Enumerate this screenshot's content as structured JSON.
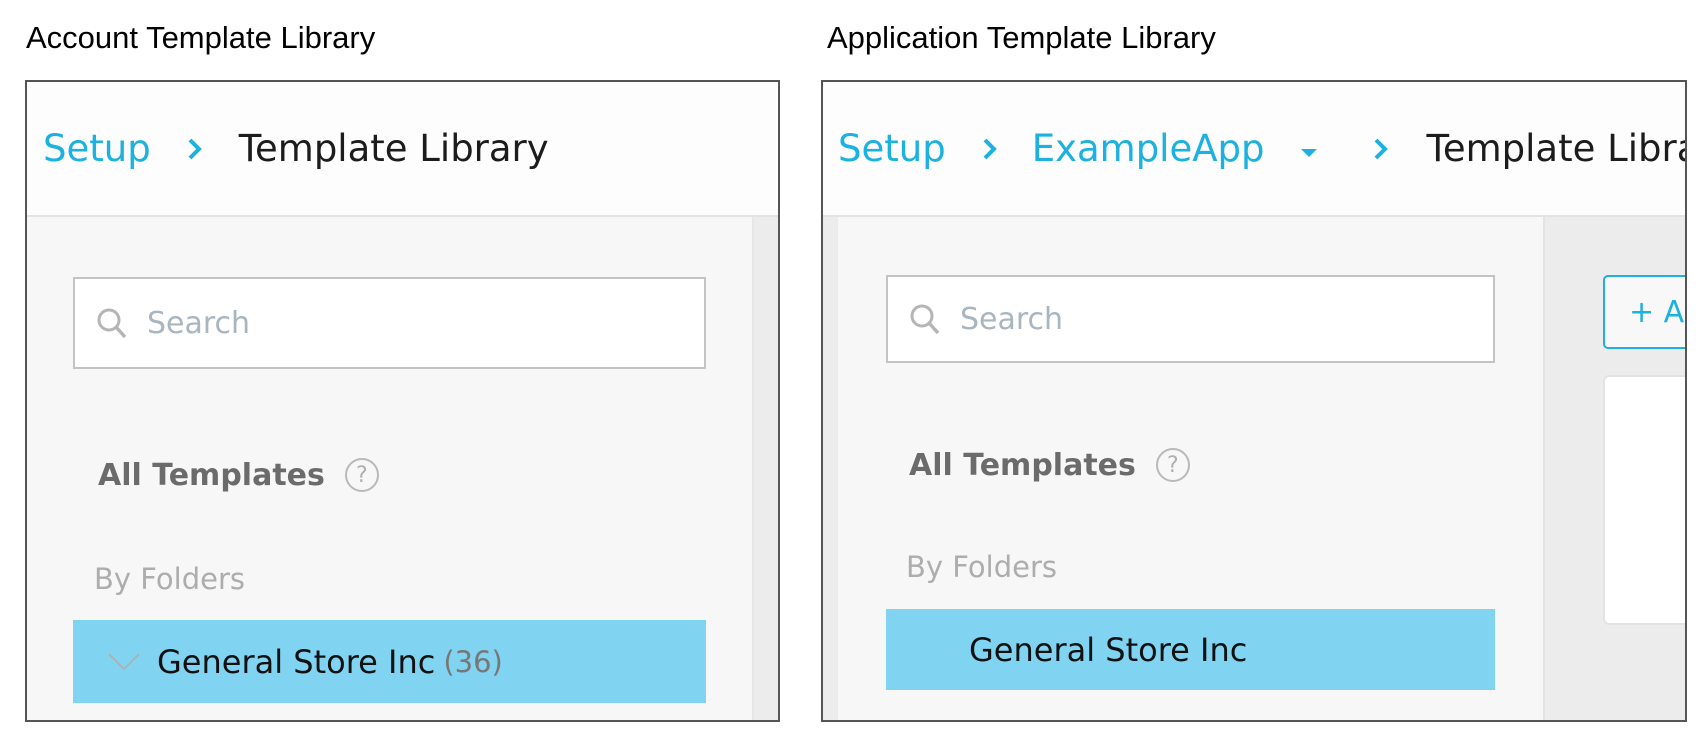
{
  "captions": {
    "account": "Account Template Library",
    "application": "Application Template Library"
  },
  "account_panel": {
    "breadcrumb": {
      "setup": "Setup",
      "separator": "›",
      "current": "Template Library"
    },
    "search": {
      "placeholder": "Search",
      "value": ""
    },
    "all_templates": {
      "label": "All Templates",
      "help_icon": "?"
    },
    "by_folders": "By Folders",
    "folders": [
      {
        "name": "General Store Inc",
        "count": "(36)",
        "expanded": true,
        "selected": true
      }
    ]
  },
  "application_panel": {
    "breadcrumb": {
      "setup": "Setup",
      "separator": "›",
      "app": "ExampleApp",
      "current": "Template Library"
    },
    "search": {
      "placeholder": "Search",
      "value": ""
    },
    "all_templates": {
      "label": "All Templates",
      "help_icon": "?"
    },
    "by_folders": "By Folders",
    "folders": [
      {
        "name": "General Store Inc",
        "selected": true
      }
    ],
    "add_button": "+ Ad"
  },
  "colors": {
    "accent": "#1bb1e0",
    "selected_row": "#81d4f1",
    "frame_border": "#555555"
  }
}
